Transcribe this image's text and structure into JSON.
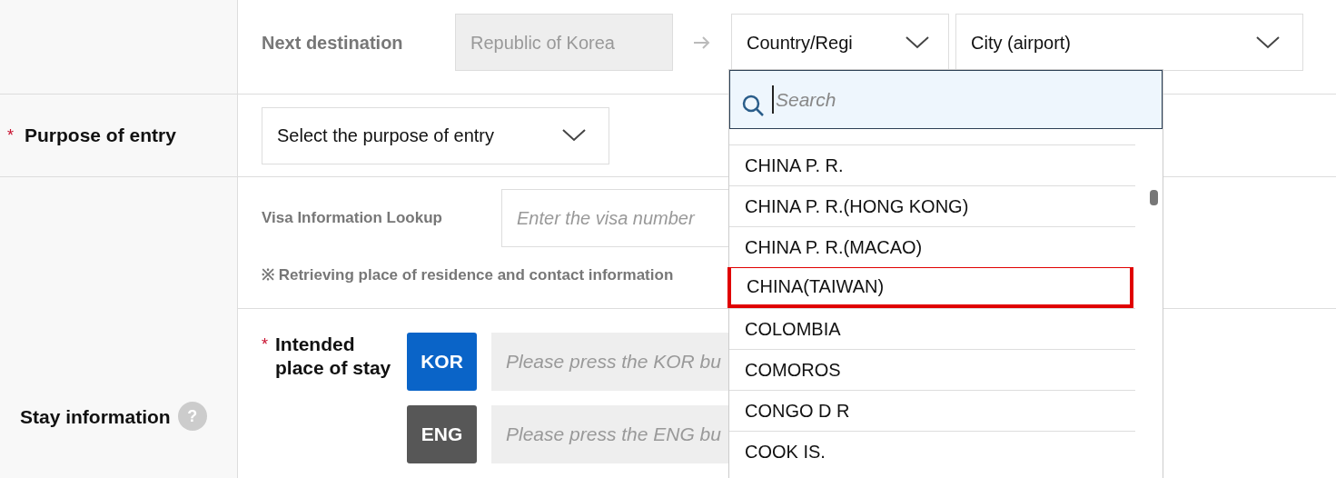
{
  "next_destination": {
    "label": "Next destination",
    "origin": "Republic of Korea",
    "country_select": "Country/Regi",
    "city_select": "City (airport)"
  },
  "purpose": {
    "label": "Purpose of entry",
    "required_mark": "*",
    "select": "Select the purpose of entry"
  },
  "stay_section": {
    "label": "Stay information",
    "help_icon": "?",
    "visa_lookup": {
      "label": "Visa Information Lookup",
      "placeholder": "Enter the visa number",
      "note": "※ Retrieving place of residence and contact information"
    },
    "intended_stay": {
      "label": "Intended place of stay",
      "required_mark": "*",
      "rows": [
        {
          "button": "KOR",
          "kind": "primary",
          "placeholder": "Please press the KOR bu"
        },
        {
          "button": "ENG",
          "kind": "secondary",
          "placeholder": "Please press the ENG bu"
        }
      ]
    }
  },
  "country_dropdown": {
    "search_placeholder": "Search",
    "items": [
      {
        "label": "CHINA P. R.",
        "highlighted": false
      },
      {
        "label": "CHINA P. R.(HONG KONG)",
        "highlighted": false
      },
      {
        "label": "CHINA P. R.(MACAO)",
        "highlighted": false
      },
      {
        "label": "CHINA(TAIWAN)",
        "highlighted": true
      },
      {
        "label": "COLOMBIA",
        "highlighted": false
      },
      {
        "label": "COMOROS",
        "highlighted": false
      },
      {
        "label": "CONGO D R",
        "highlighted": false
      },
      {
        "label": "COOK IS.",
        "highlighted": false
      }
    ]
  }
}
